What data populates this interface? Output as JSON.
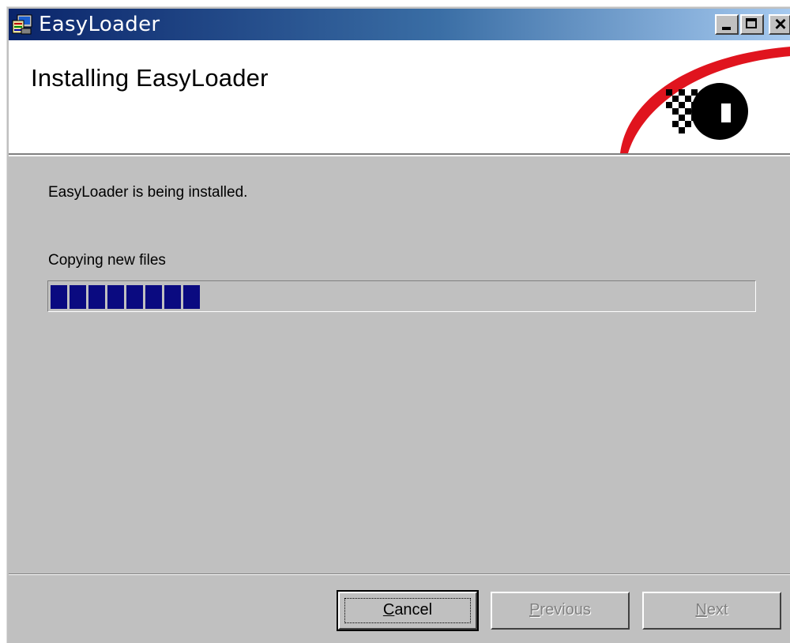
{
  "window": {
    "title": "EasyLoader"
  },
  "titlebar_buttons": {
    "minimize": "minimize",
    "maximize": "maximize",
    "close": "close"
  },
  "header": {
    "title": "Installing EasyLoader"
  },
  "body": {
    "status": "EasyLoader is being installed.",
    "action": "Copying new files",
    "progress_blocks": 8,
    "progress_percent": 21
  },
  "buttons": {
    "cancel_first": "C",
    "cancel_rest": "ancel",
    "previous_first": "P",
    "previous_rest": "revious",
    "next_first": "N",
    "next_rest": "ext"
  },
  "colors": {
    "title_start": "#0a246a",
    "title_end": "#a6caf0",
    "progress_fill": "#0a0a80",
    "logo_red": "#e0141e",
    "face": "#c0c0c0"
  },
  "icons": {
    "app_icon": "installer-computer-icon",
    "logo": "brand-logo-red-swoosh"
  }
}
